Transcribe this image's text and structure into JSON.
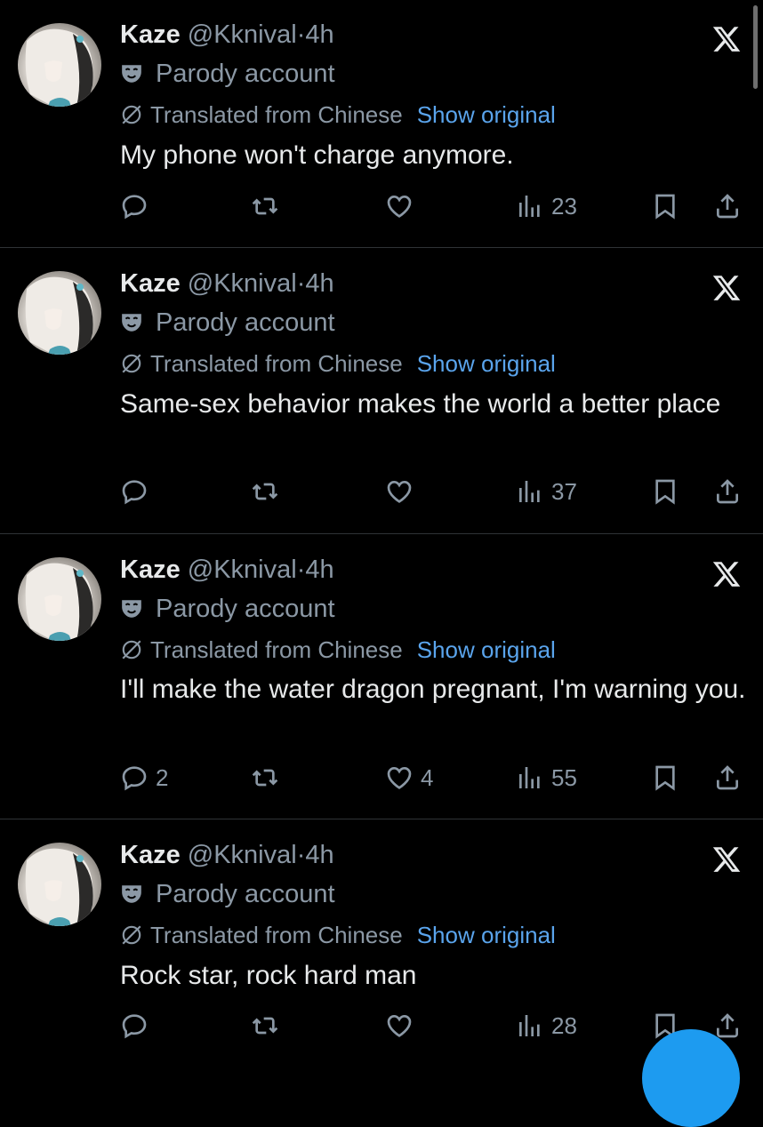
{
  "tweets": [
    {
      "name": "Kaze",
      "handle": "@Kknival",
      "dot": "·",
      "time": "4h",
      "parody": "Parody account",
      "translated": "Translated from Chinese",
      "show_original": "Show original",
      "text": "My phone won't charge anymore.",
      "replies": "",
      "likes": "",
      "views": "23"
    },
    {
      "name": "Kaze",
      "handle": "@Kknival",
      "dot": "·",
      "time": "4h",
      "parody": "Parody account",
      "translated": "Translated from Chinese",
      "show_original": "Show original",
      "text": "Same-sex behavior makes the world a better place",
      "replies": "",
      "likes": "",
      "views": "37"
    },
    {
      "name": "Kaze",
      "handle": "@Kknival",
      "dot": "·",
      "time": "4h",
      "parody": "Parody account",
      "translated": "Translated from Chinese",
      "show_original": "Show original",
      "text": "I'll make the water dragon pregnant, I'm warning you.",
      "replies": "2",
      "likes": "4",
      "views": "55"
    },
    {
      "name": "Kaze",
      "handle": "@Kknival",
      "dot": "·",
      "time": "4h",
      "parody": "Parody account",
      "translated": "Translated from Chinese",
      "show_original": "Show original",
      "text": "Rock star, rock hard man",
      "replies": "",
      "likes": "",
      "views": "28"
    }
  ],
  "icons": {
    "reply": "reply-icon",
    "retweet": "retweet-icon",
    "like": "heart-icon",
    "views": "views-icon",
    "bookmark": "bookmark-icon",
    "share": "share-icon",
    "platform": "x-logo-icon",
    "parody": "mask-icon",
    "translate": "translate-slash-icon"
  },
  "colors": {
    "background": "#000000",
    "text": "#e7e9ea",
    "muted": "#8b98a5",
    "link": "#5aa4ec",
    "divider": "#2f3336",
    "accent": "#1d9bf0"
  }
}
